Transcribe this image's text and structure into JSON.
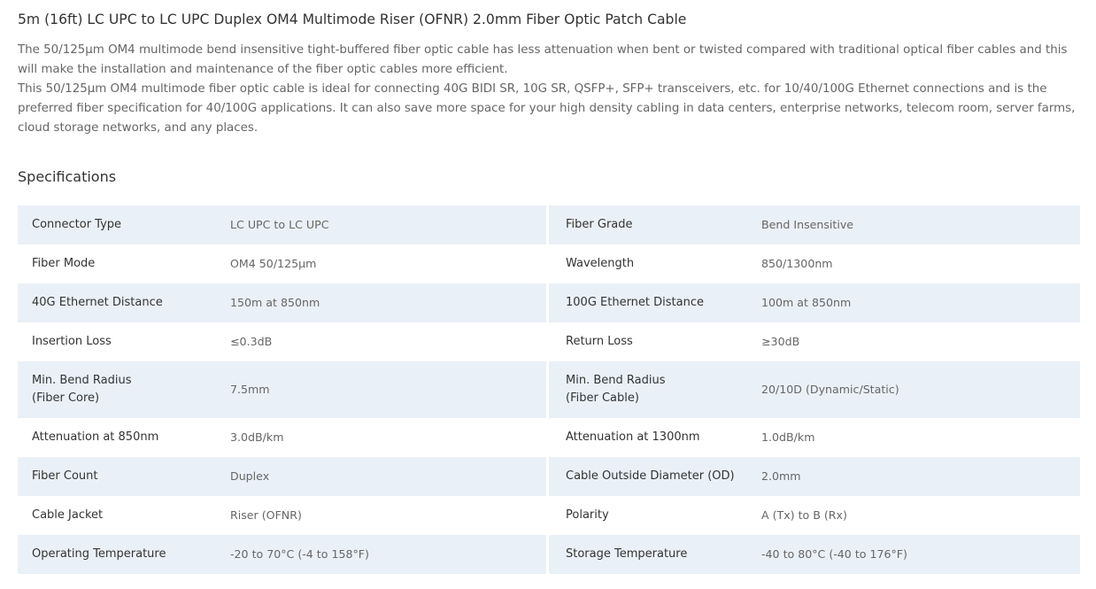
{
  "product": {
    "title": "5m (16ft) LC UPC to LC UPC Duplex OM4 Multimode Riser (OFNR) 2.0mm Fiber Optic Patch Cable",
    "description": [
      "The 50/125μm OM4 multimode bend insensitive tight-buffered fiber optic cable has less attenuation when bent or twisted compared with traditional optical fiber cables and this will make the installation and maintenance of the fiber optic cables more efficient.",
      "This 50/125μm OM4 multimode fiber optic cable is ideal for connecting 40G BIDI SR, 10G SR, QSFP+, SFP+ transceivers, etc. for 10/40/100G Ethernet connections and is the preferred fiber specification for 40/100G applications. It can also save more space for your high density cabling in data centers, enterprise networks, telecom room, server farms, cloud storage networks, and any places."
    ]
  },
  "specifications": {
    "heading": "Specifications",
    "rows": [
      {
        "left": {
          "label": [
            "Connector Type"
          ],
          "value": "LC UPC to LC UPC"
        },
        "right": {
          "label": [
            "Fiber Grade"
          ],
          "value": "Bend Insensitive"
        }
      },
      {
        "left": {
          "label": [
            "Fiber Mode"
          ],
          "value": "OM4 50/125μm"
        },
        "right": {
          "label": [
            "Wavelength"
          ],
          "value": "850/1300nm"
        }
      },
      {
        "left": {
          "label": [
            "40G Ethernet Distance"
          ],
          "value": "150m at 850nm"
        },
        "right": {
          "label": [
            "100G Ethernet Distance"
          ],
          "value": "100m at 850nm"
        }
      },
      {
        "left": {
          "label": [
            "Insertion Loss"
          ],
          "value": "≤0.3dB"
        },
        "right": {
          "label": [
            "Return Loss"
          ],
          "value": "≥30dB"
        }
      },
      {
        "left": {
          "label": [
            "Min. Bend Radius",
            "(Fiber Core)"
          ],
          "value": "7.5mm"
        },
        "right": {
          "label": [
            "Min. Bend Radius",
            "(Fiber Cable)"
          ],
          "value": "20/10D (Dynamic/Static)"
        }
      },
      {
        "left": {
          "label": [
            "Attenuation at 850nm"
          ],
          "value": "3.0dB/km"
        },
        "right": {
          "label": [
            "Attenuation at 1300nm"
          ],
          "value": "1.0dB/km"
        }
      },
      {
        "left": {
          "label": [
            "Fiber Count"
          ],
          "value": "Duplex"
        },
        "right": {
          "label": [
            "Cable Outside Diameter (OD)"
          ],
          "value": "2.0mm"
        }
      },
      {
        "left": {
          "label": [
            "Cable Jacket"
          ],
          "value": "Riser (OFNR)"
        },
        "right": {
          "label": [
            "Polarity"
          ],
          "value": "A (Tx) to B (Rx)"
        }
      },
      {
        "left": {
          "label": [
            "Operating Temperature"
          ],
          "value": "-20 to 70°C (-4 to 158°F)"
        },
        "right": {
          "label": [
            "Storage Temperature"
          ],
          "value": "-40 to 80°C (-40 to 176°F)"
        }
      }
    ]
  },
  "colors": {
    "row_shade": "#eaf0f7",
    "title_text": "#333333",
    "body_text": "#666666"
  }
}
